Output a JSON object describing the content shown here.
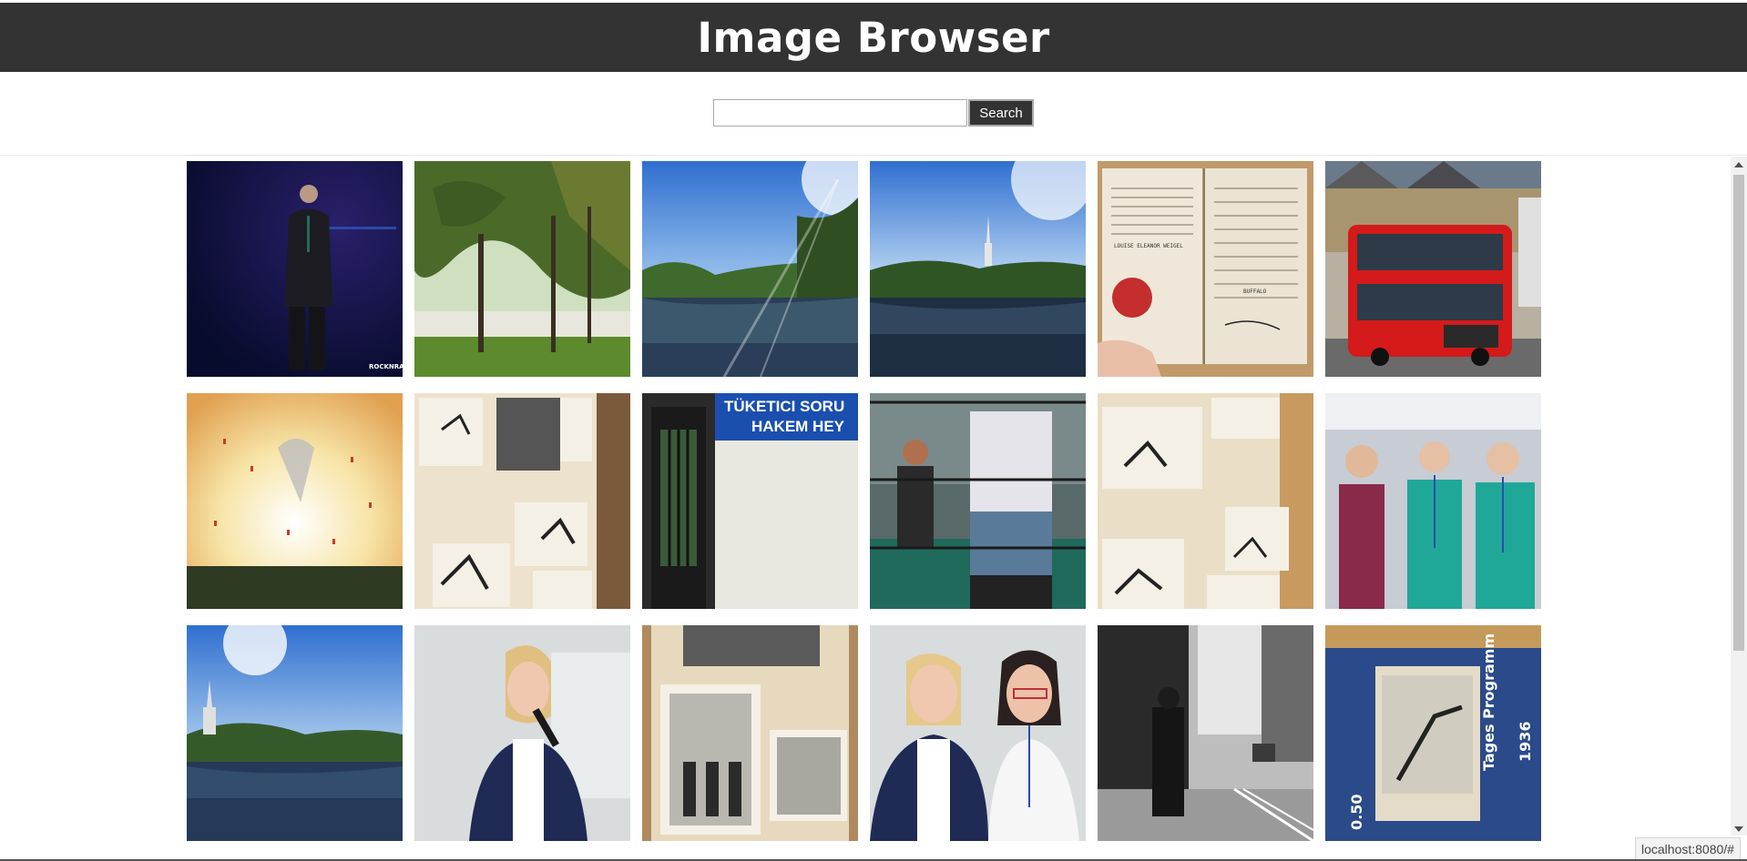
{
  "header": {
    "title": "Image Browser"
  },
  "search": {
    "value": "",
    "placeholder": "",
    "button_label": "Search"
  },
  "status": {
    "url": "localhost:8080/#"
  },
  "colors": {
    "header_bg": "#333333",
    "button_bg": "#333333",
    "text_light": "#ffffff"
  },
  "images": [
    {
      "name": "image-singer-on-stage",
      "caption": "ROCKNRA"
    },
    {
      "name": "image-trees-by-lake"
    },
    {
      "name": "image-lake-sunny-park"
    },
    {
      "name": "image-lake-with-church"
    },
    {
      "name": "image-old-passport",
      "lines": [
        "LOUISE ELEANOR WEIGEL",
        "BUFFALO"
      ]
    },
    {
      "name": "image-red-double-decker-bus"
    },
    {
      "name": "image-explosion-scene"
    },
    {
      "name": "image-photo-album-ski"
    },
    {
      "name": "image-sign-tuketici",
      "lines": [
        "TÜKETICI SORU",
        "HAKEM HEY"
      ]
    },
    {
      "name": "image-wrestling-ring"
    },
    {
      "name": "image-photo-album-jumpers"
    },
    {
      "name": "image-three-women-conference"
    },
    {
      "name": "image-lake-church-sun"
    },
    {
      "name": "image-woman-speaking-microphone"
    },
    {
      "name": "image-photo-album-winter"
    },
    {
      "name": "image-two-women-smiling"
    },
    {
      "name": "image-street-black-white"
    },
    {
      "name": "image-olympic-program-1936",
      "lines": [
        "Tages Programm",
        "1936",
        "0.50"
      ]
    }
  ]
}
